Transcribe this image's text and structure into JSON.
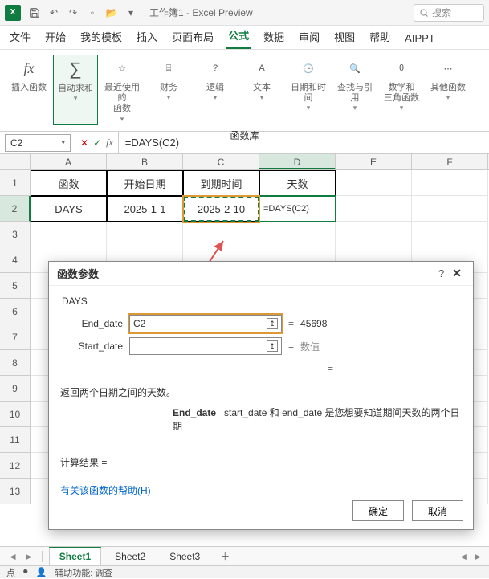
{
  "titlebar": {
    "doc_title": "工作簿1 - Excel Preview",
    "search_placeholder": "搜索"
  },
  "tabs": [
    "文件",
    "开始",
    "我的模板",
    "插入",
    "页面布局",
    "公式",
    "数据",
    "审阅",
    "视图",
    "帮助",
    "AIPPT"
  ],
  "ribbon": {
    "items": [
      {
        "label": "插入函数"
      },
      {
        "label": "自动求和"
      },
      {
        "label": "最近使用的\n函数"
      },
      {
        "label": "财务"
      },
      {
        "label": "逻辑"
      },
      {
        "label": "文本"
      },
      {
        "label": "日期和时间"
      },
      {
        "label": "查找与引用"
      },
      {
        "label": "数学和\n三角函数"
      },
      {
        "label": "其他函数"
      }
    ],
    "caption": "函数库"
  },
  "formula_bar": {
    "name": "C2",
    "formula": "=DAYS(C2)"
  },
  "grid": {
    "columns": [
      "A",
      "B",
      "C",
      "D",
      "E",
      "F"
    ],
    "rows": [
      "1",
      "2",
      "3",
      "4",
      "5",
      "6",
      "7",
      "8",
      "9",
      "10",
      "11",
      "12",
      "13"
    ],
    "header_row": [
      "函数",
      "开始日期",
      "到期时间",
      "天数"
    ],
    "data_row": [
      "DAYS",
      "2025-1-1",
      "2025-2-10",
      "=DAYS(C2)"
    ]
  },
  "dialog": {
    "title": "函数参数",
    "function_name": "DAYS",
    "params": [
      {
        "label": "End_date",
        "value": "C2",
        "result": "45698"
      },
      {
        "label": "Start_date",
        "value": "",
        "result": "数值"
      }
    ],
    "equals": "=",
    "desc": "返回两个日期之间的天数。",
    "arg_desc_label": "End_date",
    "arg_desc": "start_date 和 end_date 是您想要知道期间天数的两个日期",
    "result_label": "计算结果 = ",
    "help_link": "有关该函数的帮助(H)",
    "ok": "确定",
    "cancel": "取消"
  },
  "sheets": [
    "Sheet1",
    "Sheet2",
    "Sheet3"
  ],
  "status": {
    "mode": "点",
    "access": "辅助功能: 调查"
  }
}
